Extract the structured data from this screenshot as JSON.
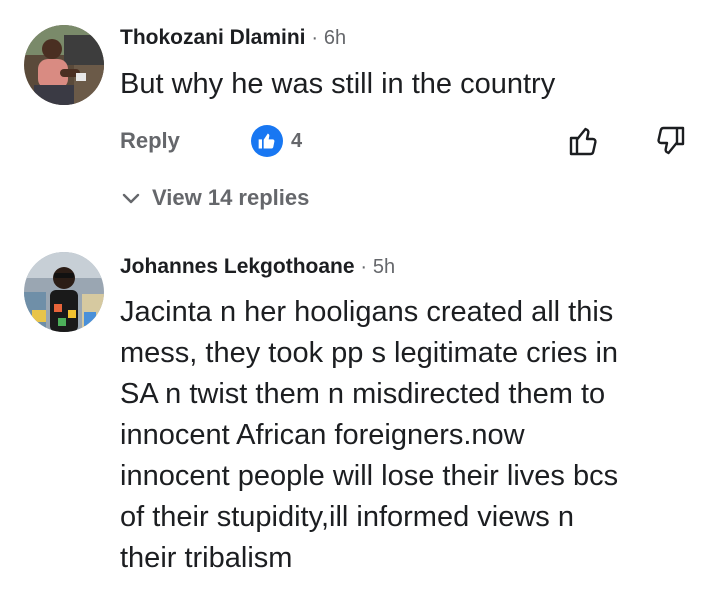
{
  "comments": [
    {
      "author": "Thokozani Dlamini",
      "separator": "·",
      "time": "6h",
      "text": "But why he was still in the country",
      "reply_label": "Reply",
      "reaction_icon": "thumbs-up-icon",
      "reaction_count": "4",
      "view_replies_label": "View 14 replies"
    },
    {
      "author": "Johannes Lekgothoane",
      "separator": "·",
      "time": "5h",
      "text": "Jacinta n her hooligans created all this\nmess, they took pp s legitimate cries in\nSA n twist them n misdirected them to\ninnocent African foreigners.now\ninnocent people will lose their lives bcs\nof their stupidity,ill informed views n\ntheir tribalism"
    }
  ],
  "colors": {
    "text_primary": "#1c1e21",
    "text_secondary": "#65676b",
    "like_blue": "#1877f2",
    "background": "#ffffff"
  }
}
